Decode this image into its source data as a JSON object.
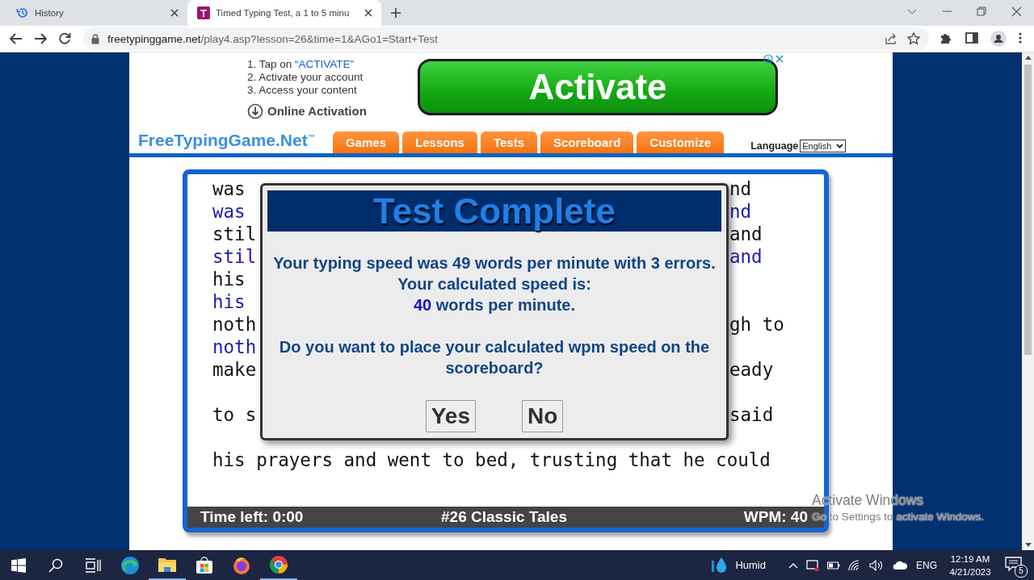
{
  "browser": {
    "tabs": [
      {
        "title": "History",
        "selected": false,
        "kind": "history"
      },
      {
        "title": "Timed Typing Test, a 1 to 5 minu",
        "selected": true,
        "kind": "site",
        "favicon_letter": "T"
      }
    ],
    "url": {
      "domain": "freetypinggame.net",
      "path": "/play4.asp?lesson=26&time=1&AGo1=Start+Test"
    }
  },
  "ad": {
    "steps": [
      {
        "text": "1. Tap on ",
        "highlight": "“ACTIVATE”"
      },
      {
        "text": "2. Activate your account"
      },
      {
        "text": "3. Access your content"
      }
    ],
    "online_activation": "Online Activation",
    "button": "Activate"
  },
  "site": {
    "logo": "FreeTypingGame.Net",
    "logo_mark": "™",
    "nav": [
      "Games",
      "Lessons",
      "Tests",
      "Scoreboard",
      "Customize"
    ],
    "language": {
      "label": "Language",
      "value": "English"
    }
  },
  "typing": {
    "lines": [
      {
        "kind": "source",
        "left": "was",
        "right": "nd"
      },
      {
        "kind": "typed",
        "left": "was",
        "right": "nd"
      },
      {
        "kind": "source",
        "left": "stil",
        "right": "and"
      },
      {
        "kind": "typed",
        "left": "stil",
        "right": "and"
      },
      {
        "kind": "source",
        "left": "his"
      },
      {
        "kind": "typed",
        "left": "his"
      },
      {
        "kind": "source",
        "left": "noth",
        "right": "gh to"
      },
      {
        "kind": "typed",
        "left": "noth"
      },
      {
        "kind": "source",
        "left": "make",
        "right": "eady"
      },
      {
        "kind": "typed"
      },
      {
        "kind": "source",
        "left": "to s",
        "right": "said"
      },
      {
        "kind": "typed"
      },
      {
        "kind": "source",
        "left": "his prayers and went to bed, trusting that he could"
      }
    ],
    "footer": {
      "time_left": "Time left: 0:00",
      "lesson": "#26 Classic Tales",
      "wpm": "WPM: 40"
    }
  },
  "modal": {
    "title": "Test Complete",
    "message": "Your typing speed was 49 words per minute with 3 errors. Your calculated speed is:",
    "speed_value": "40",
    "speed_unit": "words per minute.",
    "question": "Do you want to place your calculated wpm speed on the scoreboard?",
    "buttons": [
      "Yes",
      "No"
    ]
  },
  "taskbar": {
    "apps": [
      {
        "kind": "edge",
        "running": false
      },
      {
        "kind": "explorer",
        "running": true
      },
      {
        "kind": "store",
        "running": false
      },
      {
        "kind": "firefox",
        "running": false
      },
      {
        "kind": "chrome",
        "running": true
      }
    ],
    "weather": "Humid",
    "language": "ENG",
    "time": "12:19 AM",
    "date": "4/21/2023",
    "notifications": "5"
  },
  "watermark": {
    "title": "Activate Windows",
    "subtitle": "Go to Settings to activate Windows."
  }
}
